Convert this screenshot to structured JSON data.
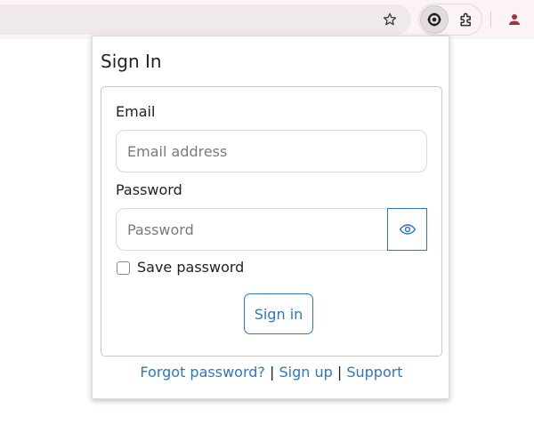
{
  "browser": {
    "toolbar_icons": [
      "star-icon",
      "extension-icon",
      "puzzle-icon",
      "profile-icon"
    ]
  },
  "popup": {
    "title": "Sign In",
    "email": {
      "label": "Email",
      "placeholder": "Email address",
      "value": ""
    },
    "password": {
      "label": "Password",
      "placeholder": "Password",
      "value": "",
      "toggle_icon": "eye-icon"
    },
    "save_password": {
      "label": "Save password",
      "checked": false
    },
    "signin_button": "Sign in",
    "links": {
      "forgot": "Forgot password?",
      "signup": "Sign up",
      "support": "Support",
      "separator": "|"
    }
  },
  "colors": {
    "accent": "#2a77c9",
    "toolbar_bg": "#fcf4f4",
    "omnibox_bg": "#efe9ec",
    "profile": "#a4343a"
  }
}
